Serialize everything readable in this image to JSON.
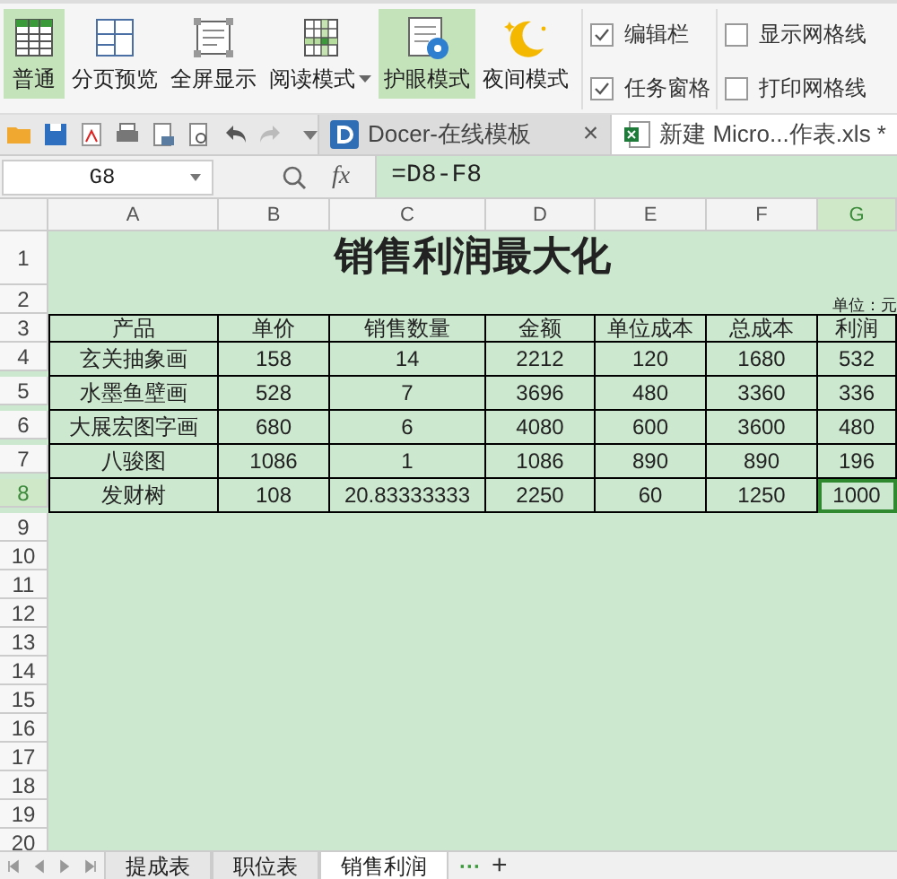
{
  "ribbon": {
    "buttons": [
      {
        "label": "普通",
        "selected": true,
        "kind": "grid",
        "dropdown": false
      },
      {
        "label": "分页预览",
        "selected": false,
        "kind": "pages",
        "dropdown": false
      },
      {
        "label": "全屏显示",
        "selected": false,
        "kind": "fullscreen",
        "dropdown": false
      },
      {
        "label": "阅读模式",
        "selected": false,
        "kind": "reading",
        "dropdown": true
      },
      {
        "label": "护眼模式",
        "selected": true,
        "kind": "eye",
        "dropdown": false
      },
      {
        "label": "夜间模式",
        "selected": false,
        "kind": "night",
        "dropdown": false
      }
    ],
    "checkbox_groups": [
      [
        {
          "label": "编辑栏",
          "checked": true
        },
        {
          "label": "任务窗格",
          "checked": true
        }
      ],
      [
        {
          "label": "显示网格线",
          "checked": false
        },
        {
          "label": "打印网格线",
          "checked": false
        }
      ]
    ]
  },
  "doc_tabs": [
    {
      "label": "Docer-在线模板",
      "selected": false,
      "kind": "docer",
      "close": "×"
    },
    {
      "label": "新建 Micro...作表.xls *",
      "selected": true,
      "kind": "excel"
    }
  ],
  "formula_bar": {
    "name_box": "G8",
    "fx": "fx",
    "formula": "=D8-F8"
  },
  "columns": [
    {
      "label": "A",
      "selected": false
    },
    {
      "label": "B",
      "selected": false
    },
    {
      "label": "C",
      "selected": false
    },
    {
      "label": "D",
      "selected": false
    },
    {
      "label": "E",
      "selected": false
    },
    {
      "label": "F",
      "selected": false
    },
    {
      "label": "G",
      "selected": true
    }
  ],
  "row_headers": [
    {
      "label": "1",
      "selected": false
    },
    {
      "label": "2",
      "selected": false
    },
    {
      "label": "3",
      "selected": false
    },
    {
      "label": "4",
      "selected": false
    },
    {
      "label": "5",
      "selected": false
    },
    {
      "label": "6",
      "selected": false
    },
    {
      "label": "7",
      "selected": false
    },
    {
      "label": "8",
      "selected": true
    },
    {
      "label": "9",
      "selected": false
    },
    {
      "label": "10",
      "selected": false
    },
    {
      "label": "11",
      "selected": false
    },
    {
      "label": "12",
      "selected": false
    },
    {
      "label": "13",
      "selected": false
    },
    {
      "label": "14",
      "selected": false
    },
    {
      "label": "15",
      "selected": false
    },
    {
      "label": "16",
      "selected": false
    },
    {
      "label": "17",
      "selected": false
    },
    {
      "label": "18",
      "selected": false
    },
    {
      "label": "19",
      "selected": false
    },
    {
      "label": "20",
      "selected": false
    }
  ],
  "title": "销售利润最大化",
  "unit": "单位：元",
  "table": {
    "header": [
      "产品",
      "单价",
      "销售数量",
      "金额",
      "单位成本",
      "总成本",
      "利润"
    ],
    "rows": [
      [
        {
          "text": "玄关抽象画",
          "selected": false
        },
        {
          "text": "158",
          "selected": false
        },
        {
          "text": "14",
          "selected": false
        },
        {
          "text": "2212",
          "selected": false
        },
        {
          "text": "120",
          "selected": false
        },
        {
          "text": "1680",
          "selected": false
        },
        {
          "text": "532",
          "selected": false
        }
      ],
      [
        {
          "text": "水墨鱼壁画",
          "selected": false
        },
        {
          "text": "528",
          "selected": false
        },
        {
          "text": "7",
          "selected": false
        },
        {
          "text": "3696",
          "selected": false
        },
        {
          "text": "480",
          "selected": false
        },
        {
          "text": "3360",
          "selected": false
        },
        {
          "text": "336",
          "selected": false
        }
      ],
      [
        {
          "text": "大展宏图字画",
          "selected": false
        },
        {
          "text": "680",
          "selected": false
        },
        {
          "text": "6",
          "selected": false
        },
        {
          "text": "4080",
          "selected": false
        },
        {
          "text": "600",
          "selected": false
        },
        {
          "text": "3600",
          "selected": false
        },
        {
          "text": "480",
          "selected": false
        }
      ],
      [
        {
          "text": "八骏图",
          "selected": false
        },
        {
          "text": "1086",
          "selected": false
        },
        {
          "text": "1",
          "selected": false
        },
        {
          "text": "1086",
          "selected": false
        },
        {
          "text": "890",
          "selected": false
        },
        {
          "text": "890",
          "selected": false
        },
        {
          "text": "196",
          "selected": false
        }
      ],
      [
        {
          "text": "发财树",
          "selected": false
        },
        {
          "text": "108",
          "selected": false
        },
        {
          "text": "20.83333333",
          "selected": false
        },
        {
          "text": "2250",
          "selected": false
        },
        {
          "text": "60",
          "selected": false
        },
        {
          "text": "1250",
          "selected": false
        },
        {
          "text": "1000",
          "selected": true
        }
      ]
    ]
  },
  "sheet_tabs": [
    {
      "label": "提成表",
      "selected": false
    },
    {
      "label": "职位表",
      "selected": false
    },
    {
      "label": "销售利润",
      "selected": true
    }
  ],
  "more": "···",
  "add": "+"
}
